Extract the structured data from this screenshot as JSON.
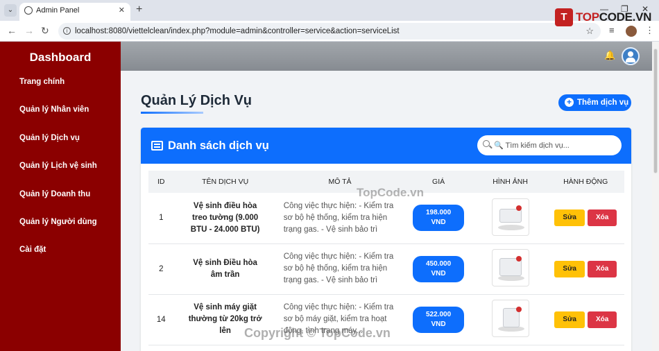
{
  "browser": {
    "tab_title": "Admin Panel",
    "url": "localhost:8080/viettelclean/index.php?module=admin&controller=service&action=serviceList"
  },
  "logo": {
    "mark": "T",
    "text_prefix": "TOP",
    "text_suffix": "CODE.VN"
  },
  "sidebar": {
    "brand": "Dashboard",
    "items": [
      {
        "label": "Trang chính"
      },
      {
        "label": "Quản lý Nhân viên"
      },
      {
        "label": "Quản lý Dịch vụ"
      },
      {
        "label": "Quản lý Lịch vệ sinh"
      },
      {
        "label": "Quản lý Doanh thu"
      },
      {
        "label": "Quản lý Người dùng"
      },
      {
        "label": "Cài đặt"
      }
    ]
  },
  "main": {
    "page_title": "Quản Lý Dịch Vụ",
    "add_button": "Thêm dịch vụ",
    "card_title": "Danh sách dịch vụ",
    "search_placeholder": "🔍 Tìm kiếm dịch vụ...",
    "table": {
      "columns": [
        "ID",
        "TÊN DỊCH VỤ",
        "MÔ TẢ",
        "GIÁ",
        "HÌNH ẢNH",
        "HÀNH ĐỘNG"
      ],
      "rows": [
        {
          "id": "1",
          "name": "Vệ sinh điều hòa treo tường (9.000 BTU - 24.000 BTU)",
          "desc": "Công việc thực hiện: - Kiểm tra sơ bộ hệ thống, kiểm tra hiện trạng gas. - Vệ sinh bảo trì dàn...",
          "price_amount": "198.000",
          "price_unit": "VND"
        },
        {
          "id": "2",
          "name": "Vệ sinh Điều hòa âm trần",
          "desc": "Công việc thực hiện: - Kiểm tra sơ bộ hệ thống, kiểm tra hiện trạng gas. - Vệ sinh bảo trì dàn...",
          "price_amount": "450.000",
          "price_unit": "VND"
        },
        {
          "id": "14",
          "name": "Vệ sinh máy giặt thường từ 20kg trở lên",
          "desc": "Công việc thực hiện: - Kiểm tra sơ bộ máy giặt, kiểm tra hoạt động, tình trạng máy...",
          "price_amount": "522.000",
          "price_unit": "VND"
        }
      ],
      "edit_label": "Sửa",
      "delete_label": "Xóa"
    }
  },
  "watermarks": {
    "center": "TopCode.vn",
    "bottom": "Copyright © TopCode.vn"
  },
  "colors": {
    "sidebar": "#8b0000",
    "primary": "#0d6efd",
    "edit": "#ffc107",
    "delete": "#dc3545"
  }
}
